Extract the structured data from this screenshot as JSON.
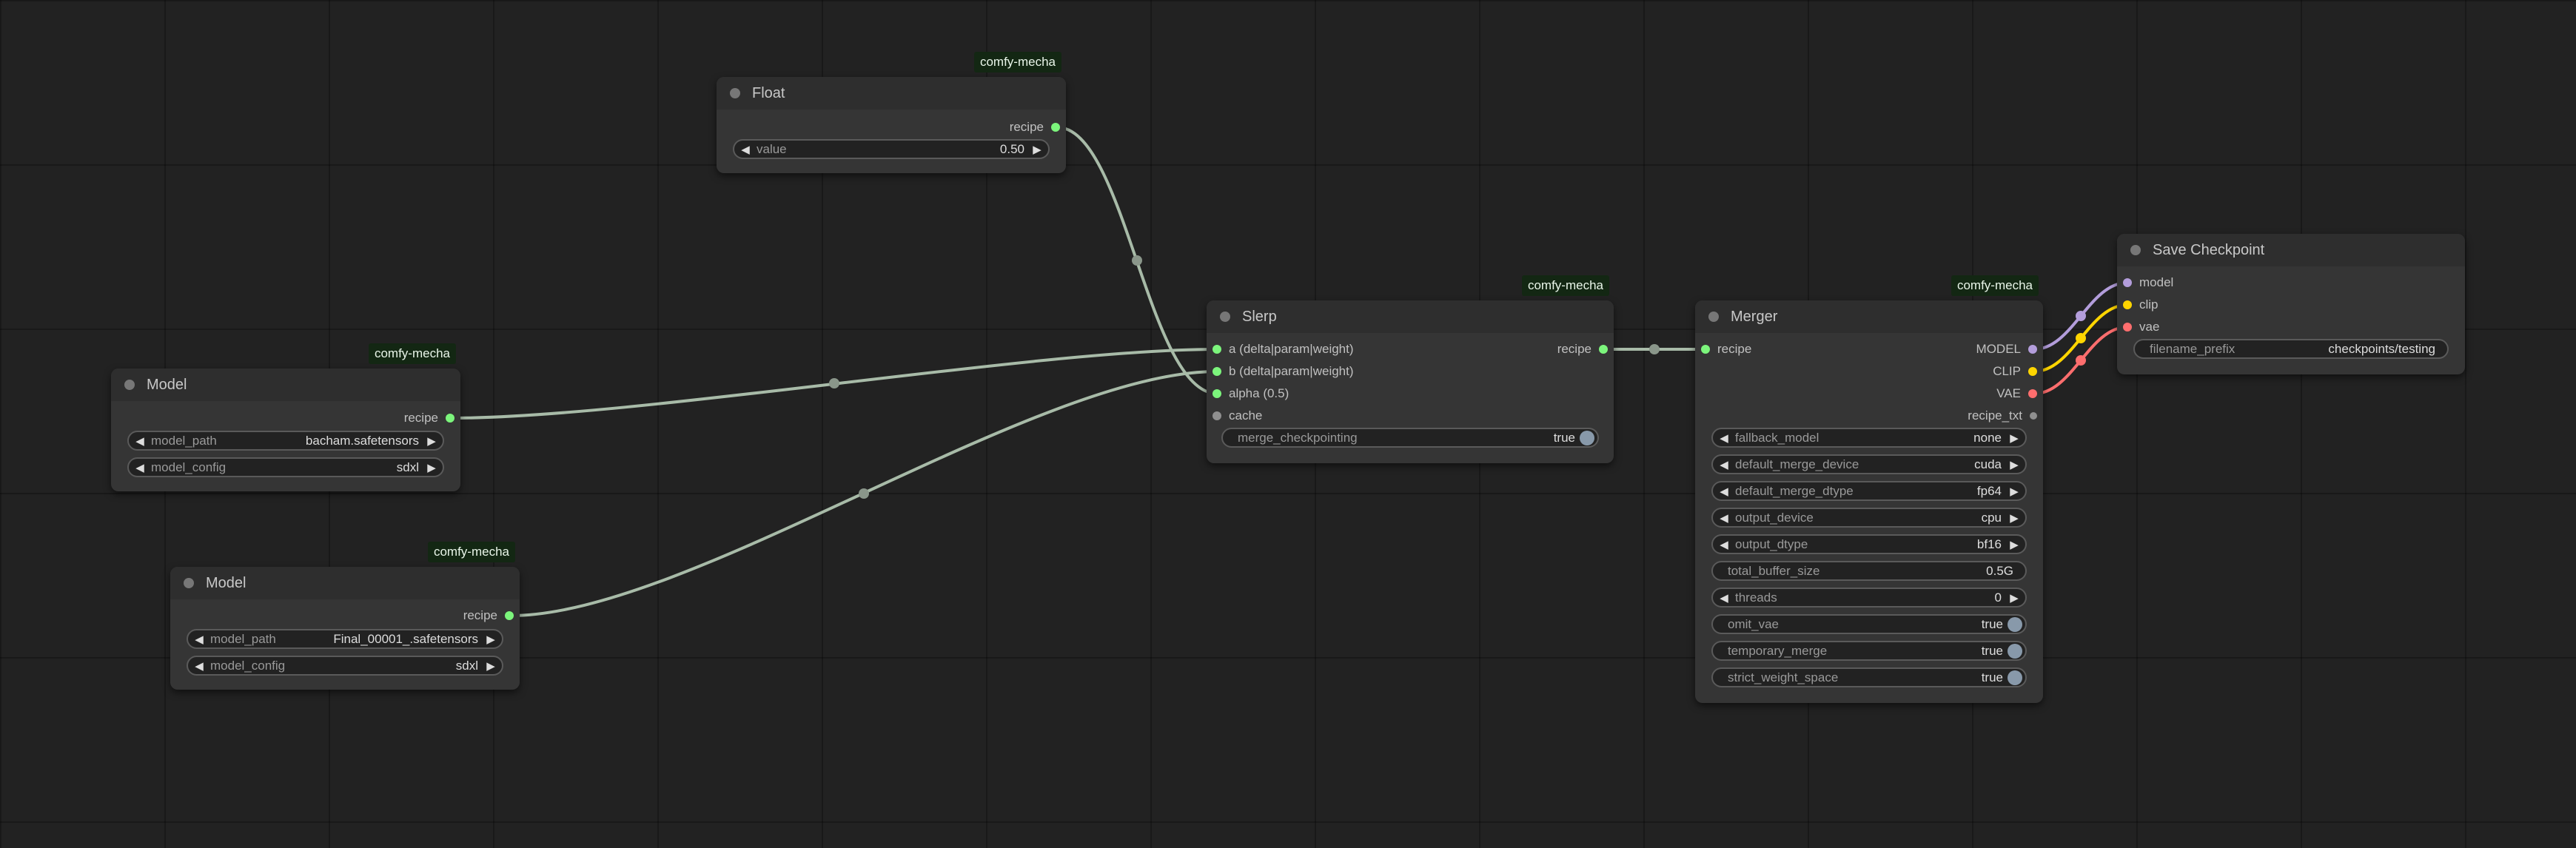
{
  "nodes": {
    "float": {
      "badge": "comfy-mecha",
      "title": "Float",
      "outputs": [
        {
          "label": "recipe",
          "color": "#7cf57c"
        }
      ],
      "widgets": [
        {
          "name": "value",
          "value": "0.50"
        }
      ]
    },
    "model1": {
      "badge": "comfy-mecha",
      "title": "Model",
      "outputs": [
        {
          "label": "recipe",
          "color": "#7cf57c"
        }
      ],
      "widgets": [
        {
          "name": "model_path",
          "value": "bacham.safetensors"
        },
        {
          "name": "model_config",
          "value": "sdxl"
        }
      ]
    },
    "model2": {
      "badge": "comfy-mecha",
      "title": "Model",
      "outputs": [
        {
          "label": "recipe",
          "color": "#7cf57c"
        }
      ],
      "widgets": [
        {
          "name": "model_path",
          "value": "Final_00001_.safetensors"
        },
        {
          "name": "model_config",
          "value": "sdxl"
        }
      ]
    },
    "slerp": {
      "badge": "comfy-mecha",
      "title": "Slerp",
      "inputs": [
        {
          "label": "a (delta|param|weight)",
          "color": "#7cf57c"
        },
        {
          "label": "b (delta|param|weight)",
          "color": "#7cf57c"
        },
        {
          "label": "alpha (0.5)",
          "color": "#7cf57c"
        },
        {
          "label": "cache",
          "color": "#8f8f8f"
        }
      ],
      "outputs": [
        {
          "label": "recipe",
          "color": "#7cf57c"
        }
      ],
      "widgets": [
        {
          "name": "merge_checkpointing",
          "value": "true"
        }
      ]
    },
    "merger": {
      "badge": "comfy-mecha",
      "title": "Merger",
      "inputs": [
        {
          "label": "recipe",
          "color": "#7cf57c"
        }
      ],
      "outputs": [
        {
          "label": "MODEL",
          "color": "#b39ddb"
        },
        {
          "label": "CLIP",
          "color": "#ffd500"
        },
        {
          "label": "VAE",
          "color": "#ff6e6e"
        },
        {
          "label": "recipe_txt",
          "color": "#8f8f8f"
        }
      ],
      "widgets": [
        {
          "name": "fallback_model",
          "value": "none"
        },
        {
          "name": "default_merge_device",
          "value": "cuda"
        },
        {
          "name": "default_merge_dtype",
          "value": "fp64"
        },
        {
          "name": "output_device",
          "value": "cpu"
        },
        {
          "name": "output_dtype",
          "value": "bf16"
        },
        {
          "name": "total_buffer_size",
          "value": "0.5G"
        },
        {
          "name": "threads",
          "value": "0"
        },
        {
          "name": "omit_vae",
          "value": "true"
        },
        {
          "name": "temporary_merge",
          "value": "true"
        },
        {
          "name": "strict_weight_space",
          "value": "true"
        }
      ]
    },
    "save": {
      "title": "Save Checkpoint",
      "inputs": [
        {
          "label": "model",
          "color": "#b39ddb"
        },
        {
          "label": "clip",
          "color": "#ffd500"
        },
        {
          "label": "vae",
          "color": "#ff6e6e"
        }
      ],
      "widgets": [
        {
          "name": "filename_prefix",
          "value": "checkpoints/testing"
        }
      ]
    }
  },
  "colors": {
    "canvas": "#222222",
    "node_body": "#353535",
    "node_header": "#2e2e2e",
    "recipe_link": "#a8bba8",
    "model_link": "#b39ddb",
    "clip_link": "#ffd500",
    "vae_link": "#ff6e6e",
    "badge_bg": "#132713"
  }
}
